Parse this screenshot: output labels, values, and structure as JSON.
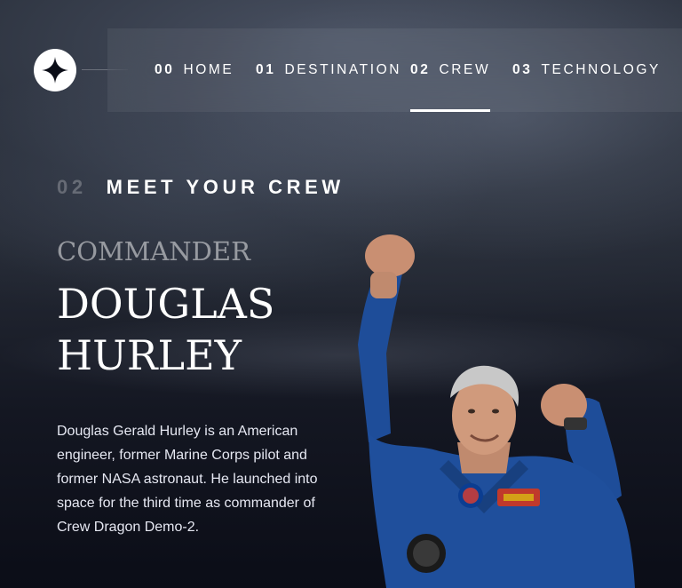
{
  "nav": {
    "items": [
      {
        "num": "00",
        "label": "HOME"
      },
      {
        "num": "01",
        "label": "DESTINATION"
      },
      {
        "num": "02",
        "label": "CREW",
        "active": true
      },
      {
        "num": "03",
        "label": "TECHNOLOGY"
      }
    ]
  },
  "section": {
    "num": "02",
    "title": "MEET YOUR CREW"
  },
  "crew": {
    "role": "COMMANDER",
    "name_line1": "DOUGLAS",
    "name_line2": "HURLEY",
    "bio": "Douglas Gerald Hurley is an American engineer, former Marine Corps pilot and former NASA astronaut. He launched into space for the third time as commander of Crew Dragon Demo-2."
  },
  "icons": {
    "logo": "star-icon"
  },
  "colors": {
    "background": "#0b0d17",
    "text": "#ffffff",
    "suit": "#1f4f9c"
  }
}
